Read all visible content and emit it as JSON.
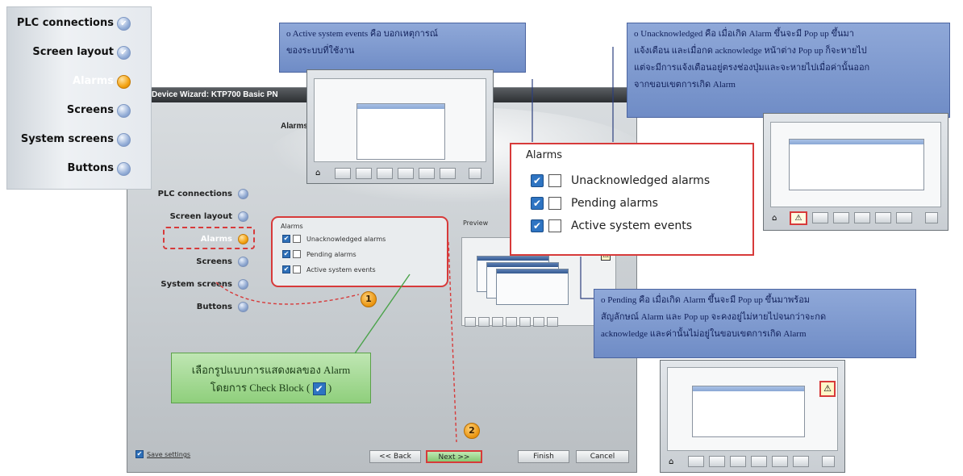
{
  "wizard": {
    "title": "Device Wizard: KTP700 Basic PN",
    "heading": "Alarms",
    "nav": [
      "PLC connections",
      "Screen layout",
      "Alarms",
      "Screens",
      "System screens",
      "Buttons"
    ],
    "group_title": "Alarms",
    "options": [
      "Unacknowledged alarms",
      "Pending alarms",
      "Active system events"
    ],
    "preview_label": "Preview",
    "save_settings": "Save settings",
    "buttons": {
      "back": "<< Back",
      "next": "Next >>",
      "finish": "Finish",
      "cancel": "Cancel"
    }
  },
  "step_panel": {
    "items": [
      "PLC connections",
      "Screen layout",
      "Alarms",
      "Screens",
      "System screens",
      "Buttons"
    ],
    "active": "Alarms"
  },
  "zoom": {
    "title": "Alarms",
    "options": [
      "Unacknowledged alarms",
      "Pending alarms",
      "Active system events"
    ]
  },
  "callouts": {
    "active_events": [
      "o Active system events คือ บอกเหตุการณ์",
      "ของระบบที่ใช้งาน"
    ],
    "unacknowledged": [
      "o Unacknowledged คือ เมื่อเกิด Alarm ขึ้นจะมี Pop up ขึ้นมา",
      "แจ้งเตือน และเมื่อกด acknowledge หน้าต่าง Pop up ก็จะหายไป",
      "แต่จะมีการแจ้งเตือนอยู่ตรงช่องปุ่มและจะหายไปเมื่อค่านั้นออก",
      "จากขอบเขตการเกิด Alarm"
    ],
    "pending": [
      "o Pending คือ เมื่อเกิด Alarm ขึ้นจะมี Pop up ขึ้นมาพร้อม",
      "สัญลักษณ์ Alarm และ Pop up จะคงอยู่ไม่หายไปจนกว่าจะกด",
      "acknowledge และค่านั้นไม่อยู่ในขอบเขตการเกิด Alarm"
    ],
    "green_note": [
      "เลือกรูปแบบการแสดงผลของ Alarm",
      "โดยการ Check Block (",
      ")"
    ]
  },
  "badges": [
    "1",
    "2"
  ],
  "icons": {
    "checked": "✔",
    "alarm": "⚠",
    "home": "⌂"
  }
}
